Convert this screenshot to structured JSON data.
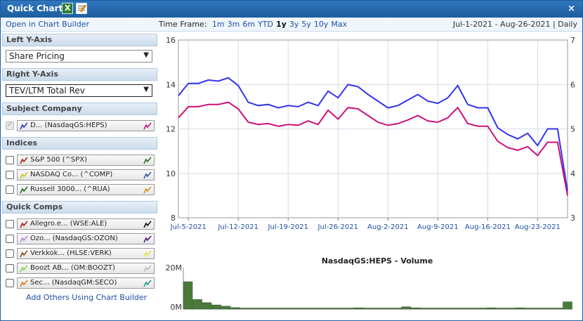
{
  "window": {
    "title": "Quick Chart",
    "icons": [
      "excel-export-icon",
      "edit-chart-icon",
      "close-icon"
    ],
    "close_glyph": "×"
  },
  "toolbar": {
    "open_builder": "Open in Chart Builder",
    "time_frame_label": "Time Frame:",
    "time_frames": [
      {
        "label": "1m",
        "active": false
      },
      {
        "label": "3m",
        "active": false
      },
      {
        "label": "6m",
        "active": false
      },
      {
        "label": "YTD",
        "active": false
      },
      {
        "label": "1y",
        "active": true
      },
      {
        "label": "3y",
        "active": false
      },
      {
        "label": "5y",
        "active": false
      },
      {
        "label": "10y",
        "active": false
      },
      {
        "label": "Max",
        "active": false
      }
    ],
    "date_range": "Jul-1-2021 - Aug-26-2021 | Daily"
  },
  "sidebar": {
    "left_axis_title": "Left Y-Axis",
    "left_axis_value": "Share Pricing",
    "right_axis_title": "Right Y-Axis",
    "right_axis_value": "TEV/LTM Total Rev",
    "subject_title": "Subject Company",
    "subject": {
      "label": "D... (NasdaqGS:HEPS)",
      "color_left": "#3333dd",
      "color_right": "#cc1177"
    },
    "indices_title": "Indices",
    "indices": [
      {
        "label": "S&P 500 (^SPX)",
        "color_left": "#aa2222",
        "color_right": "#2a6e2a"
      },
      {
        "label": "NASDAQ Co... (^COMP)",
        "color_left": "#c8c81e",
        "color_right": "#2b5a9e"
      },
      {
        "label": "Russell 3000... (^RUA)",
        "color_left": "#1e6a2a",
        "color_right": "#d98f1e"
      }
    ],
    "comps_title": "Quick Comps",
    "comps": [
      {
        "label": "Allegro.e... (WSE:ALE)",
        "color_left": "#b01818",
        "color_right": "#111111"
      },
      {
        "label": "Ozo... (NasdaqGS:OZON)",
        "color_left": "#b088e0",
        "color_right": "#4b1a7a"
      },
      {
        "label": "Verkkok... (HLSE:VERK)",
        "color_left": "#8a4a14",
        "color_right": "#e6e63a"
      },
      {
        "label": "Boozt AB... (OM:BOOZT)",
        "color_left": "#7ad65a",
        "color_right": "#bbbbbb"
      },
      {
        "label": "Sec... (NasdaqGM:SECO)",
        "color_left": "#e07a1a",
        "color_right": "#1a9a8a"
      }
    ],
    "add_others": "Add Others Using Chart Builder"
  },
  "chart_data": [
    {
      "type": "line",
      "title": "",
      "x_ticks": [
        "Jul-5-2021",
        "Jul-12-2021",
        "Jul-19-2021",
        "Jul-26-2021",
        "Aug-2-2021",
        "Aug-9-2021",
        "Aug-16-2021",
        "Aug-23-2021"
      ],
      "ylim_left": [
        8,
        16
      ],
      "yticks_left": [
        "8",
        "10",
        "12",
        "14",
        "16"
      ],
      "ylim_right": [
        3,
        7
      ],
      "yticks_right": [
        "3",
        "4",
        "5",
        "6",
        "7"
      ],
      "grid": true,
      "series": [
        {
          "axis": "left",
          "color": "#3333ee",
          "values": [
            13.5,
            14.05,
            14.05,
            14.2,
            14.15,
            14.3,
            13.95,
            13.2,
            13.05,
            13.1,
            12.95,
            13.05,
            13.0,
            13.2,
            13.05,
            13.7,
            13.4,
            14.0,
            13.9,
            13.55,
            13.25,
            12.95,
            13.05,
            13.3,
            13.55,
            13.25,
            13.15,
            13.4,
            13.95,
            13.1,
            12.95,
            12.95,
            12.05,
            11.75,
            11.55,
            11.8,
            11.25,
            12.0,
            12.0,
            9.2
          ]
        },
        {
          "axis": "right",
          "color": "#cc1177",
          "values": [
            5.25,
            5.5,
            5.5,
            5.55,
            5.55,
            5.6,
            5.45,
            5.15,
            5.1,
            5.12,
            5.06,
            5.1,
            5.08,
            5.18,
            5.1,
            5.42,
            5.22,
            5.48,
            5.45,
            5.3,
            5.15,
            5.08,
            5.12,
            5.2,
            5.3,
            5.18,
            5.15,
            5.25,
            5.48,
            5.12,
            5.06,
            5.06,
            4.72,
            4.58,
            4.52,
            4.6,
            4.4,
            4.7,
            4.7,
            3.5
          ]
        }
      ]
    },
    {
      "type": "bar",
      "title": "NasdaqGS:HEPS - Volume",
      "yticks": [
        "20M",
        "0M"
      ],
      "ylim": [
        0,
        20
      ],
      "values": [
        13.2,
        4.6,
        3.1,
        2.0,
        1.4,
        0.7,
        0.5,
        0.5,
        0.5,
        0.5,
        0.5,
        0.5,
        0.5,
        0.5,
        0.5,
        0.5,
        0.5,
        0.5,
        0.6,
        0.5,
        0.5,
        0.5,
        0.5,
        1.1,
        0.6,
        0.5,
        0.5,
        0.5,
        0.5,
        0.5,
        0.5,
        0.5,
        0.6,
        0.5,
        0.5,
        0.6,
        0.5,
        0.5,
        0.5,
        0.5,
        3.5
      ]
    }
  ],
  "colors": {
    "title_bar": "#1d5e9e",
    "volume_bar": "#4a7a3a",
    "link": "#1f4fa3"
  }
}
